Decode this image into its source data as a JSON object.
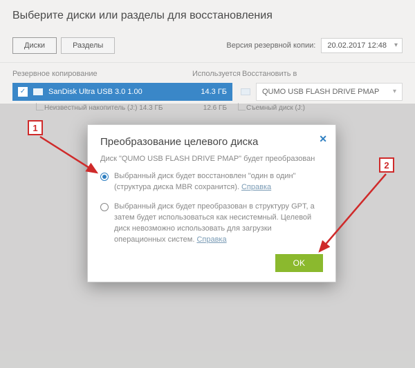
{
  "header": {
    "title": "Выберите диски или разделы для восстановления"
  },
  "toolbar": {
    "tab_disks": "Диски",
    "tab_partitions": "Разделы",
    "backup_version_label": "Версия резервной копии:",
    "backup_version_value": "20.02.2017 12:48"
  },
  "columns": {
    "backup": "Резервное копирование",
    "used": "Используется",
    "restore_to": "Восстановить в"
  },
  "source": {
    "name": "SanDisk Ultra USB 3.0 1.00",
    "used": "14.3 ГБ",
    "sub_name": "Неизвестный накопитель (J:) 14.3 ГБ",
    "sub_used": "12.6 ГБ"
  },
  "dest": {
    "name": "QUMO USB FLASH DRIVE PMAP",
    "sub_name": "Съемный диск (J:)"
  },
  "modal": {
    "title": "Преобразование целевого диска",
    "subtitle": "Диск \"QUMO USB FLASH DRIVE PMAP\" будет преобразован",
    "opt1_text": "Выбранный диск будет восстановлен \"один в один\" (структура диска MBR сохранится). ",
    "opt2_text": "Выбранный диск будет преобразован в структуру GPT, а затем будет использоваться как несистемный. Целевой диск невозможно использовать для загрузки операционных систем. ",
    "reference": "Справка",
    "ok": "OK"
  },
  "annotations": {
    "step1": "1",
    "step2": "2"
  }
}
